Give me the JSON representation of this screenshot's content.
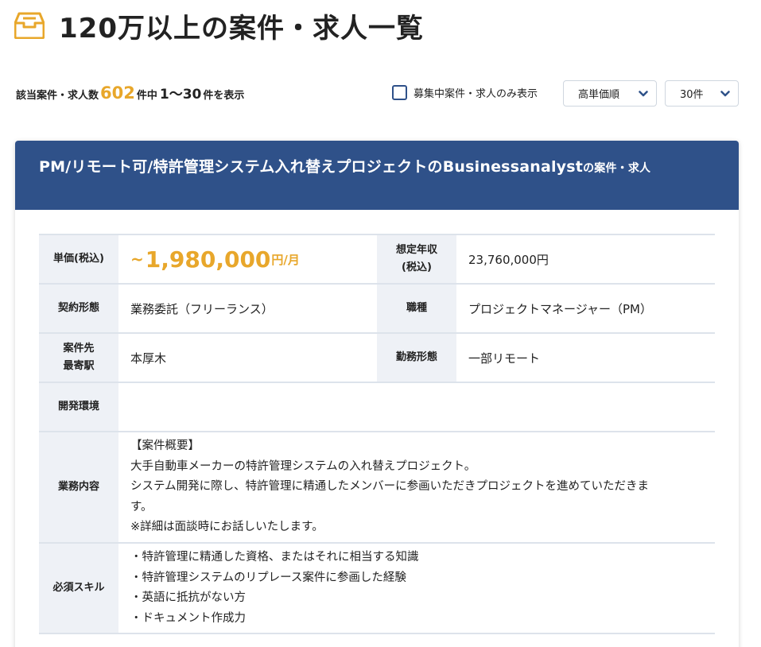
{
  "header": {
    "icon": "inbox-tray-icon",
    "title": "120万以上の案件・求人一覧"
  },
  "results": {
    "prefix": "該当案件・求人数",
    "total": "602",
    "middle": "件中",
    "range": "1〜30",
    "suffix": "件を表示"
  },
  "filters": {
    "recruiting_only_label": "募集中案件・求人のみ表示",
    "recruiting_only_checked": false,
    "sort_value": "高単価順",
    "per_page_value": "30件"
  },
  "colors": {
    "brand": "#2f5189",
    "accent": "#e8a72b",
    "table_head_bg": "#eef1f6"
  },
  "job": {
    "title": "PM/リモート可/特許管理システム入れ替えプロジェクトのBusinessanalyst",
    "title_suffix": "の案件・求人",
    "price_label": "単価(税込)",
    "price_tilde": "~",
    "price_amount": "1,980,000",
    "price_unit": "円/月",
    "annual_label_1": "想定年収",
    "annual_label_2": "(税込)",
    "annual_value": "23,760,000円",
    "contract_label": "契約形態",
    "contract_value": "業務委託（フリーランス）",
    "role_label": "職種",
    "role_value": "プロジェクトマネージャー（PM）",
    "station_label_1": "案件先",
    "station_label_2": "最寄駅",
    "station_value": "本厚木",
    "work_style_label": "勤務形態",
    "work_style_value": "一部リモート",
    "env_label": "開発環境",
    "env_value": "",
    "description_label": "業務内容",
    "description_lines": [
      "【案件概要】",
      "大手自動車メーカーの特許管理システムの入れ替えプロジェクト。",
      "システム開発に際し、特許管理に精通したメンバーに参画いただきプロジェクトを進めていただきま",
      "す。",
      "※詳細は面談時にお話しいたします。"
    ],
    "skills_label": "必須スキル",
    "skills_lines": [
      "・特許管理に精通した資格、またはそれに相当する知識",
      "・特許管理システムのリプレース案件に参画した経験",
      "・英語に抵抗がない方",
      "・ドキュメント作成力"
    ]
  }
}
